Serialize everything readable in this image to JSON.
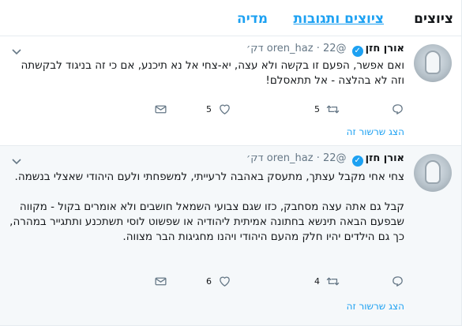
{
  "tabs": {
    "items": [
      "ציוצים",
      "ציוצים ותגובות",
      "מדיה"
    ]
  },
  "tweets": [
    {
      "name": "אורן חזן",
      "handle": "@oren_haz",
      "dot": "·",
      "time": "22 דק׳",
      "paragraphs": [
        "ואם אפשר, הפעם זו בקשה ולא עצה, יא-צחי אל נא תיכנע, אם כי זה בניגוד לבקשתה וזה לא בהלצה - אל תתאסלם!"
      ],
      "reply_count": "",
      "retweet_count": "5",
      "like_count": "5",
      "show_thread": "הצג שרשור זה"
    },
    {
      "name": "אורן חזן",
      "handle": "@oren_haz",
      "dot": "·",
      "time": "22 דק׳",
      "paragraphs": [
        "צחי אחי מקבל עצתך, מתעסק באהבה לרעייתי, למשפחתי ולעם היהודי שאצלי בנשמה.",
        "קבל גם אתה עצה מסחבק, כזו שגם צבועי השמאל חושבים ולא אומרים בקול - מקווה שבפעם הבאה תינשא בחתונה אמיתית ליהודיה או שפשוט לוסי תשתכנע ותתגייר במהרה, כך גם הילדים יהיו חלק מהעם היהודי ויהנו מחגיגות הבר מצווה."
      ],
      "reply_count": "",
      "retweet_count": "4",
      "like_count": "6",
      "show_thread": "הצג שרשור זה"
    }
  ],
  "icons": {
    "verified": "verified-badge-icon",
    "caret": "chevron-down-icon",
    "reply": "reply-icon",
    "retweet": "retweet-icon",
    "like": "heart-icon",
    "dm": "envelope-icon"
  },
  "colors": {
    "accent": "#1da1f2",
    "muted": "#657786",
    "text": "#14171a",
    "hover_bg": "#f5f8fa"
  }
}
